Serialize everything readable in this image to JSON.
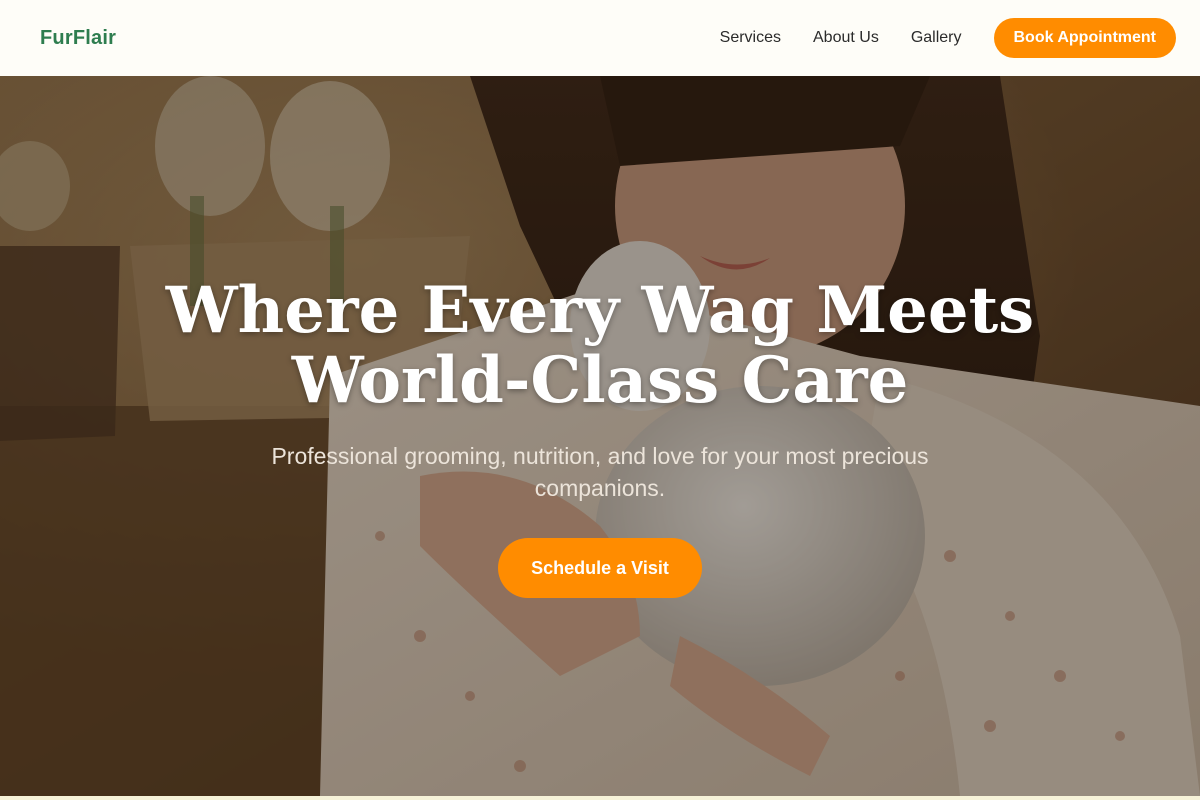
{
  "header": {
    "logo": "FurFlair",
    "nav": [
      "Services",
      "About Us",
      "Gallery"
    ],
    "cta_label": "Book Appointment"
  },
  "hero": {
    "title_line1": "Where Every Wag Meets",
    "title_line2": "World-Class Care",
    "subtitle": "Professional grooming, nutrition, and love for your most precious companions.",
    "cta_label": "Schedule a Visit"
  },
  "colors": {
    "brand": "#2e7d4f",
    "accent": "#ff8c00",
    "header_bg": "#fefdf8"
  }
}
